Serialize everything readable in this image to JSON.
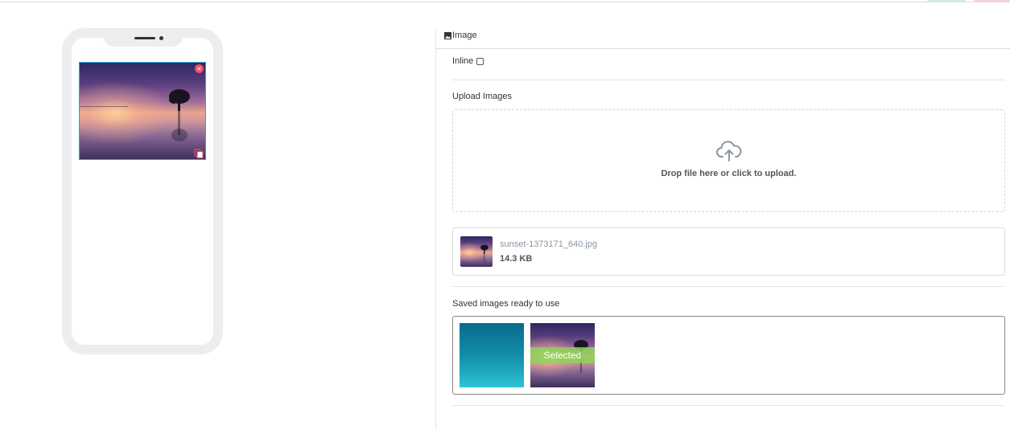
{
  "panel": {
    "title": "Image",
    "inline_label": "Inline",
    "inline_checked": false,
    "upload_label": "Upload Images",
    "dropzone_text": "Drop file here or click to upload.",
    "file": {
      "name": "sunset-1373171_640.jpg",
      "size": "14.3 KB"
    },
    "saved_label": "Saved images ready to use",
    "saved_images": [
      {
        "name": "teal-gradient",
        "selected": false
      },
      {
        "name": "sunset",
        "selected": true,
        "badge": "Selected"
      }
    ]
  },
  "colors": {
    "selection_border": "#27a6e5",
    "remove_badge": "#ef4b6b",
    "selected_band": "#8cd25a",
    "phone_frame": "#ededf0"
  },
  "icons": {
    "remove": "×"
  }
}
